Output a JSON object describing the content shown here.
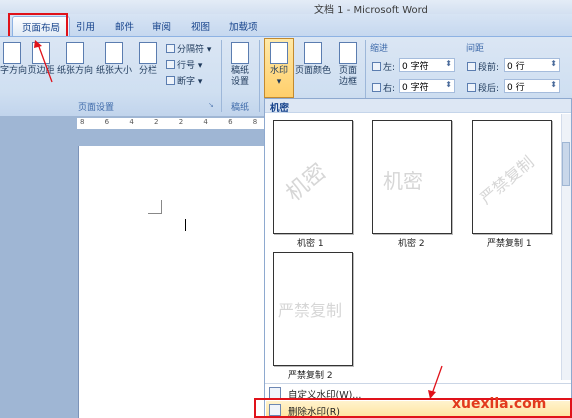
{
  "window": {
    "title": "文档 1 - Microsoft Word"
  },
  "tabs": [
    {
      "label": "页面布局",
      "active": true
    },
    {
      "label": "引用"
    },
    {
      "label": "邮件"
    },
    {
      "label": "审阅"
    },
    {
      "label": "视图"
    },
    {
      "label": "加载项"
    }
  ],
  "ribbon": {
    "page_setup": {
      "label": "页面设置",
      "buttons": [
        "字方向",
        "页边距",
        "纸张方向",
        "纸张大小",
        "分栏"
      ],
      "small": [
        "分隔符",
        "行号",
        "断字"
      ]
    },
    "draft": {
      "button": "稿纸\n设置",
      "label": "稿纸"
    },
    "background": {
      "buttons": [
        "水印",
        "页面颜色",
        "页面\n边框"
      ]
    },
    "indent": {
      "label": "缩进",
      "left_label": "左:",
      "left_value": "0 字符",
      "right_label": "右:",
      "right_value": "0 字符"
    },
    "spacing": {
      "label": "间距",
      "before_label": "段前:",
      "before_value": "0 行",
      "after_label": "段后:",
      "after_value": "0 行"
    }
  },
  "ruler": {
    "numbers": "8 6 4 2 2 4 6 8"
  },
  "watermark_panel": {
    "header": "机密",
    "items": [
      {
        "label": "机密 1",
        "watermark": "机密"
      },
      {
        "label": "机密 2",
        "watermark": "机密"
      },
      {
        "label": "严禁复制 1",
        "watermark": "严禁复制"
      },
      {
        "label": "严禁复制 2",
        "watermark": "严禁复制"
      }
    ],
    "menu": [
      {
        "label": "自定义水印(W)..."
      },
      {
        "label": "删除水印(R)"
      }
    ]
  },
  "footer_watermark": "xuexila.com",
  "colors": {
    "highlight_red": "#e0121a",
    "accent": "#15428b"
  }
}
